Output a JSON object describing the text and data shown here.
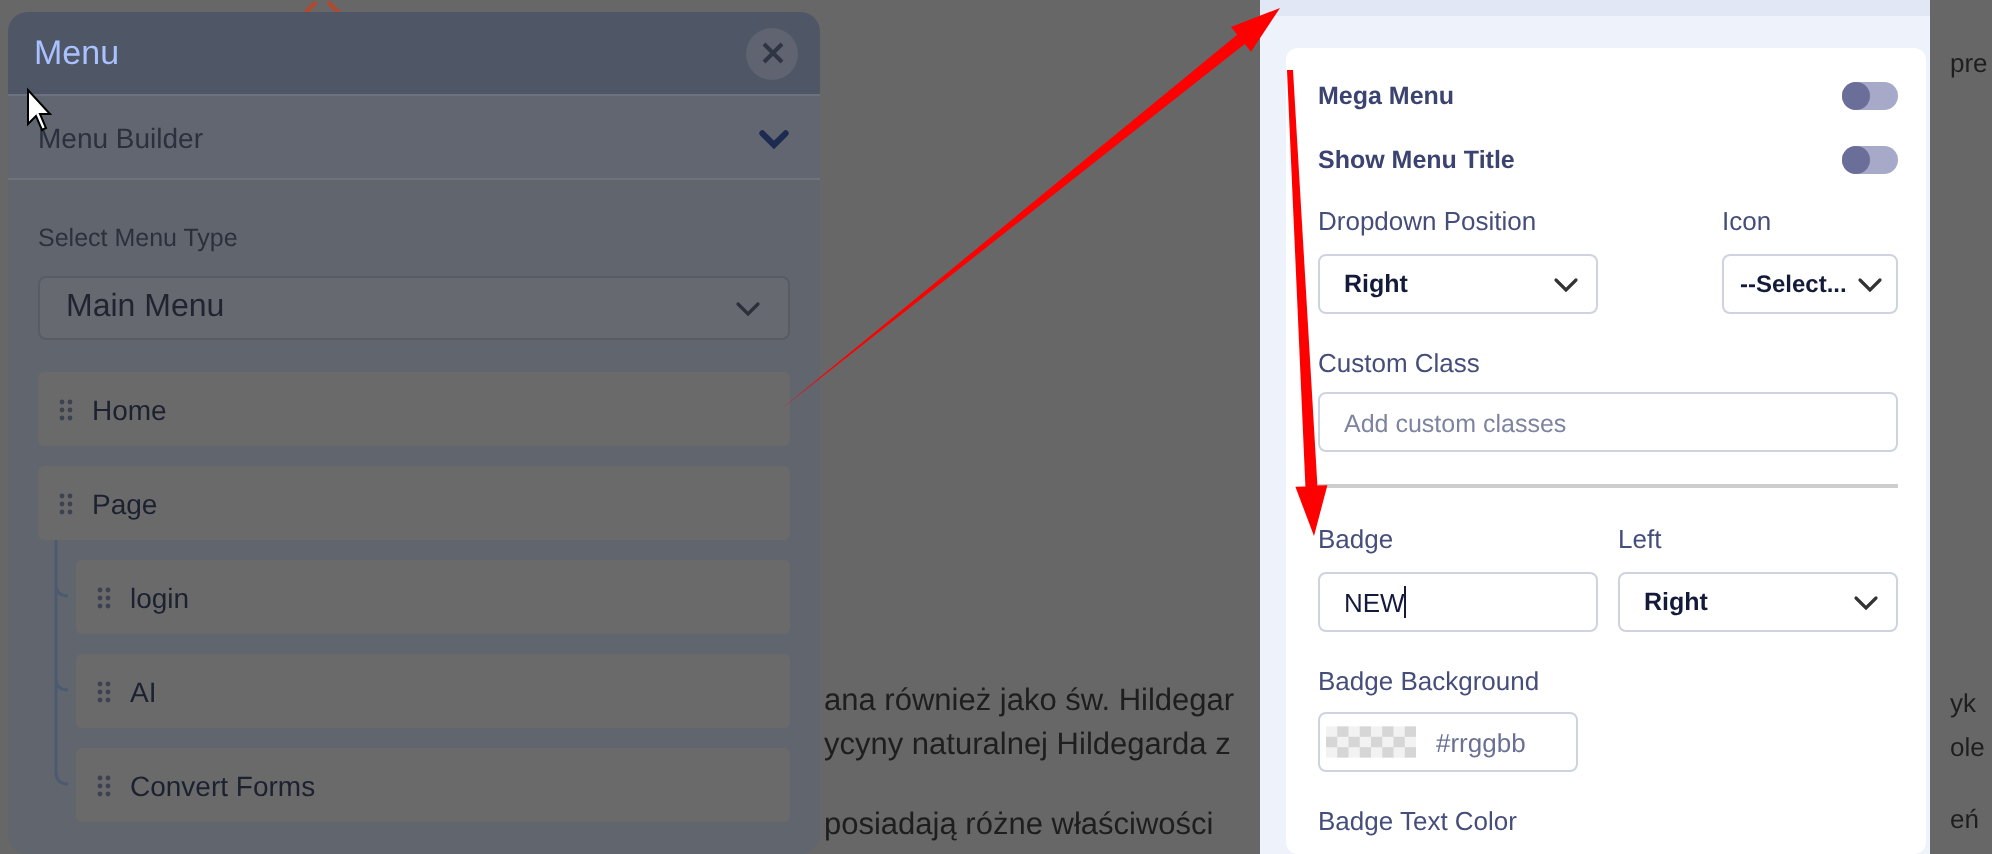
{
  "background_page": {
    "middle_lines": [
      "ana również jako św. Hildegar",
      "ycyny naturalnej Hildegarda z",
      "posiadają różne właściwości"
    ],
    "right_lines": [
      "pre",
      "yk",
      "ole",
      "eń"
    ]
  },
  "menu_panel": {
    "title": "Menu",
    "section": {
      "label": "Menu Builder",
      "expanded": true
    },
    "menu_type_label": "Select Menu Type",
    "menu_type": "Main Menu",
    "items": [
      {
        "label": "Home"
      },
      {
        "label": "Page",
        "children": [
          {
            "label": "login"
          },
          {
            "label": "AI"
          },
          {
            "label": "Convert Forms"
          }
        ]
      }
    ]
  },
  "settings_panel": {
    "toggles": [
      {
        "label": "Mega Menu",
        "on": false
      },
      {
        "label": "Show Menu Title",
        "on": false
      }
    ],
    "dropdown_position": {
      "label": "Dropdown Position",
      "value": "Right"
    },
    "icon": {
      "label": "Icon",
      "value": "--Select..."
    },
    "custom_class": {
      "label": "Custom Class",
      "placeholder": "Add custom classes"
    },
    "badge": {
      "label": "Badge",
      "value": "NEW"
    },
    "badge_position": {
      "label": "Left",
      "value": "Right"
    },
    "badge_background": {
      "label": "Badge Background",
      "placeholder": "#rrggbb"
    },
    "badge_text_color": {
      "label": "Badge Text Color"
    }
  }
}
